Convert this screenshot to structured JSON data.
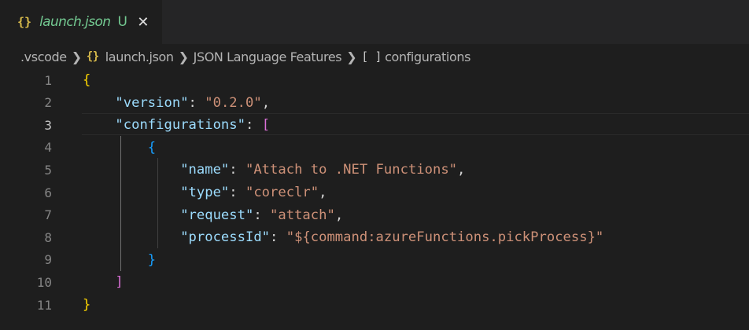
{
  "tab": {
    "icon": "{}",
    "icon_name": "json-braces-icon",
    "label": "launch.json",
    "status": "U",
    "close": "✕"
  },
  "breadcrumb": {
    "folder": ".vscode",
    "file_icon": "{}",
    "file": "launch.json",
    "section": "JSON Language Features",
    "symbol_icon": "[ ]",
    "symbol": "configurations"
  },
  "editor": {
    "line_numbers": [
      "1",
      "2",
      "3",
      "4",
      "5",
      "6",
      "7",
      "8",
      "9",
      "10",
      "11"
    ],
    "active_line": 3,
    "lines": [
      [
        {
          "t": "{",
          "c": "b1"
        }
      ],
      [
        {
          "t": "    "
        },
        {
          "t": "\"version\"",
          "c": "k"
        },
        {
          "t": ": ",
          "c": "p"
        },
        {
          "t": "\"0.2.0\"",
          "c": "s"
        },
        {
          "t": ",",
          "c": "p"
        }
      ],
      [
        {
          "t": "    "
        },
        {
          "t": "\"configurations\"",
          "c": "k"
        },
        {
          "t": ": ",
          "c": "p"
        },
        {
          "t": "[",
          "c": "b2"
        }
      ],
      [
        {
          "t": "        "
        },
        {
          "t": "{",
          "c": "b3"
        }
      ],
      [
        {
          "t": "            "
        },
        {
          "t": "\"name\"",
          "c": "k"
        },
        {
          "t": ": ",
          "c": "p"
        },
        {
          "t": "\"Attach to .NET Functions\"",
          "c": "s"
        },
        {
          "t": ",",
          "c": "p"
        }
      ],
      [
        {
          "t": "            "
        },
        {
          "t": "\"type\"",
          "c": "k"
        },
        {
          "t": ": ",
          "c": "p"
        },
        {
          "t": "\"coreclr\"",
          "c": "s"
        },
        {
          "t": ",",
          "c": "p"
        }
      ],
      [
        {
          "t": "            "
        },
        {
          "t": "\"request\"",
          "c": "k"
        },
        {
          "t": ": ",
          "c": "p"
        },
        {
          "t": "\"attach\"",
          "c": "s"
        },
        {
          "t": ",",
          "c": "p"
        }
      ],
      [
        {
          "t": "            "
        },
        {
          "t": "\"processId\"",
          "c": "k"
        },
        {
          "t": ": ",
          "c": "p"
        },
        {
          "t": "\"${command:azureFunctions.pickProcess}\"",
          "c": "s"
        }
      ],
      [
        {
          "t": "        "
        },
        {
          "t": "}",
          "c": "b3"
        }
      ],
      [
        {
          "t": "    "
        },
        {
          "t": "]",
          "c": "b2"
        }
      ],
      [
        {
          "t": "}",
          "c": "b1"
        }
      ]
    ]
  },
  "colors": {
    "background": "#1e1e1e",
    "key": "#9cdcfe",
    "string": "#ce9178",
    "bracket_level1": "#ffd700",
    "bracket_level2": "#da70d6",
    "bracket_level3": "#179fff",
    "untracked": "#73c991"
  }
}
